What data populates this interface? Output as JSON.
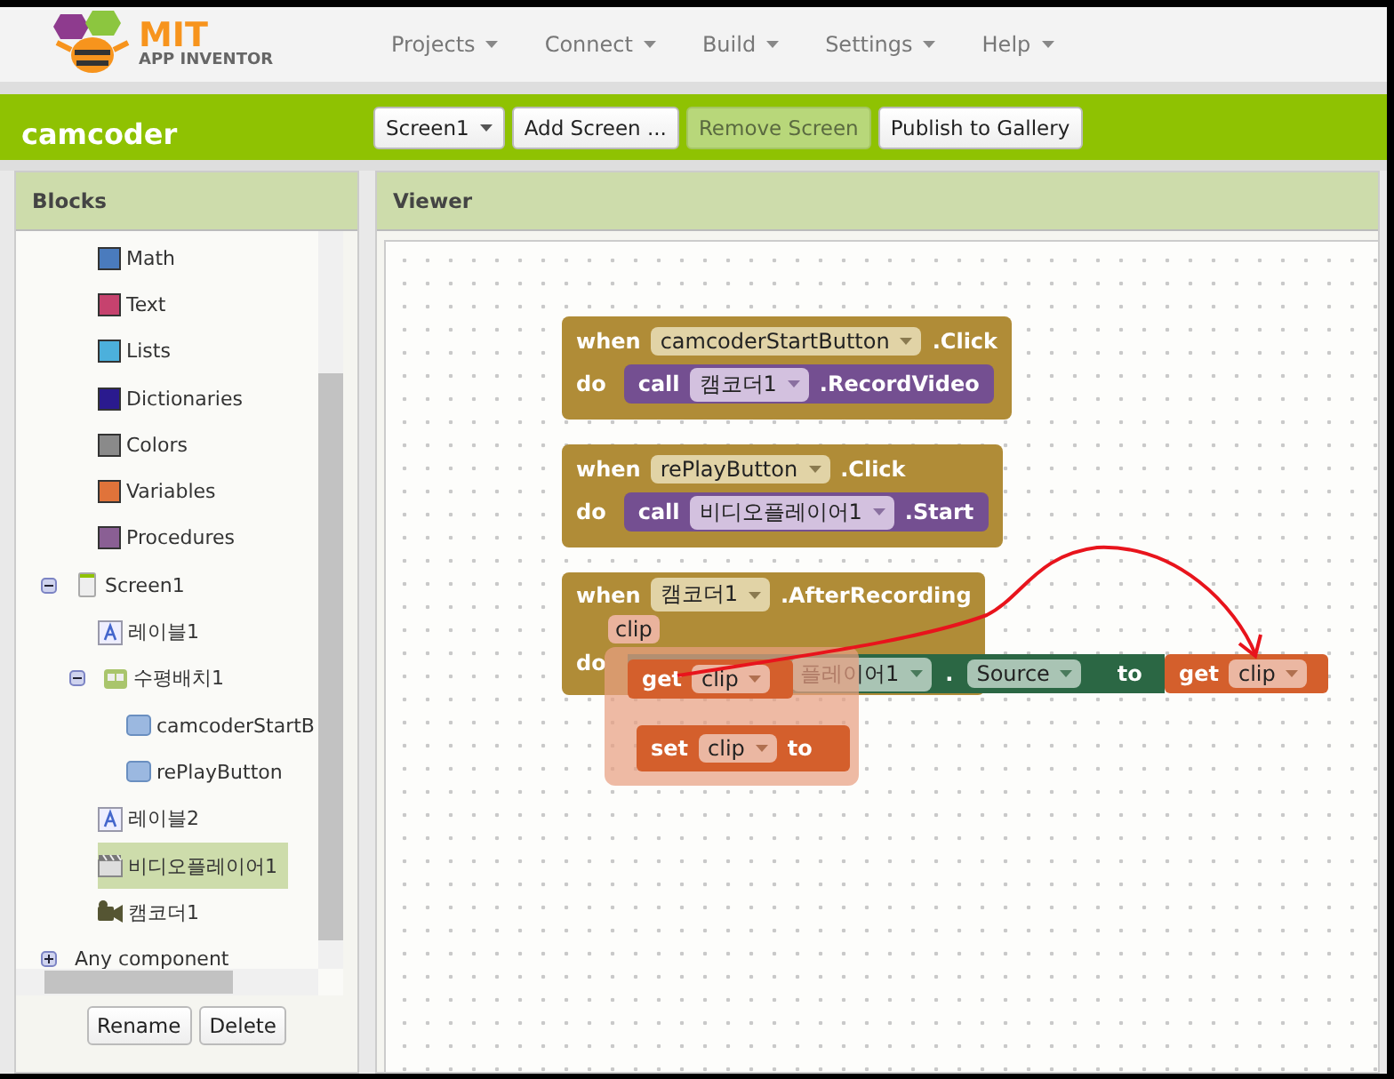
{
  "logo": {
    "title": "MIT",
    "subtitle": "APP INVENTOR"
  },
  "menu": [
    {
      "label": "Projects"
    },
    {
      "label": "Connect"
    },
    {
      "label": "Build"
    },
    {
      "label": "Settings"
    },
    {
      "label": "Help"
    }
  ],
  "project": {
    "name": "camcoder"
  },
  "toolbar": [
    {
      "label": "Screen1",
      "kind": "dropdown",
      "disabled": false
    },
    {
      "label": "Add Screen ...",
      "kind": "button",
      "disabled": false
    },
    {
      "label": "Remove Screen",
      "kind": "button",
      "disabled": true
    },
    {
      "label": "Publish to Gallery",
      "kind": "button",
      "disabled": false
    }
  ],
  "blocks_panel": {
    "title": "Blocks",
    "builtins": [
      {
        "label": "Math",
        "color": "#4a7bbd"
      },
      {
        "label": "Text",
        "color": "#c6426e"
      },
      {
        "label": "Lists",
        "color": "#4cb0dc"
      },
      {
        "label": "Dictionaries",
        "color": "#2a1a8e"
      },
      {
        "label": "Colors",
        "color": "#8a8a8a"
      },
      {
        "label": "Variables",
        "color": "#e0733a"
      },
      {
        "label": "Procedures",
        "color": "#8a5f94"
      }
    ],
    "tree": [
      {
        "label": "Screen1",
        "kind": "screen",
        "expanded": true,
        "selected": false,
        "children": [
          {
            "label": "레이블1",
            "kind": "label",
            "selected": false
          },
          {
            "label": "수평배치1",
            "kind": "arrangement",
            "expanded": true,
            "selected": false,
            "children": [
              {
                "label": "camcoderStartB",
                "kind": "button",
                "selected": false
              },
              {
                "label": "rePlayButton",
                "kind": "button",
                "selected": false
              }
            ]
          },
          {
            "label": "레이블2",
            "kind": "label",
            "selected": false
          },
          {
            "label": "비디오플레이어1",
            "kind": "video",
            "selected": true
          },
          {
            "label": "캠코더1",
            "kind": "camcorder",
            "selected": false
          }
        ]
      },
      {
        "label": "Any component",
        "kind": "category",
        "expanded": false,
        "selected": false
      }
    ],
    "buttons": [
      "Rename",
      "Delete"
    ]
  },
  "viewer": {
    "title": "Viewer",
    "events": [
      {
        "when": "when",
        "component": "camcoderStartButton",
        "event": ".Click",
        "do": "do",
        "call": {
          "keyword": "call",
          "component": "캠코더1",
          "method": ".RecordVideo"
        }
      },
      {
        "when": "when",
        "component": "rePlayButton",
        "event": ".Click",
        "do": "do",
        "call": {
          "keyword": "call",
          "component": "비디오플레이어1",
          "method": ".Start"
        }
      },
      {
        "when": "when",
        "component": "캠코더1",
        "event": ".AfterRecording",
        "param": "clip",
        "do": "do"
      }
    ],
    "setter": {
      "component": "플레이어1",
      "dot": ".",
      "property": "Source",
      "to": "to",
      "value": {
        "keyword": "get",
        "variable": "clip"
      }
    },
    "flyout": [
      {
        "kind": "get",
        "keyword": "get",
        "variable": "clip"
      },
      {
        "kind": "set",
        "keyword": "set",
        "variable": "clip",
        "to": "to"
      }
    ]
  }
}
